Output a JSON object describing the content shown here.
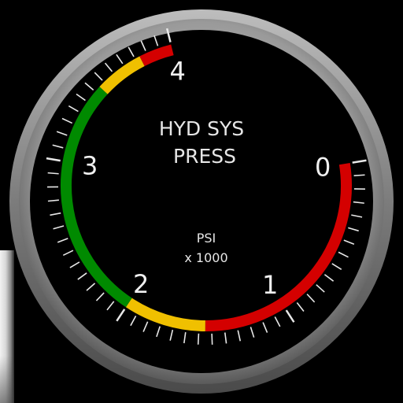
{
  "gauge": {
    "title_line1": "HYD SYS",
    "title_line2": "PRESS",
    "unit_line1": "PSI",
    "unit_line2": "x 1000",
    "scale_labels": [
      "0",
      "1",
      "2",
      "3",
      "4"
    ],
    "scale_min": 0,
    "scale_max": 4,
    "bands": [
      {
        "from": 0.0,
        "to": 1.5,
        "color": "#d40000"
      },
      {
        "from": 1.5,
        "to": 2.0,
        "color": "#f0c000"
      },
      {
        "from": 2.0,
        "to": 3.5,
        "color": "#008a00"
      },
      {
        "from": 3.5,
        "to": 3.8,
        "color": "#f0c000"
      },
      {
        "from": 3.8,
        "to": 4.0,
        "color": "#d40000"
      }
    ],
    "colors": {
      "face": "#000000",
      "bezel": "#8c8c8c",
      "tick": "#e8e8e8",
      "label": "#f0f0f0"
    }
  }
}
